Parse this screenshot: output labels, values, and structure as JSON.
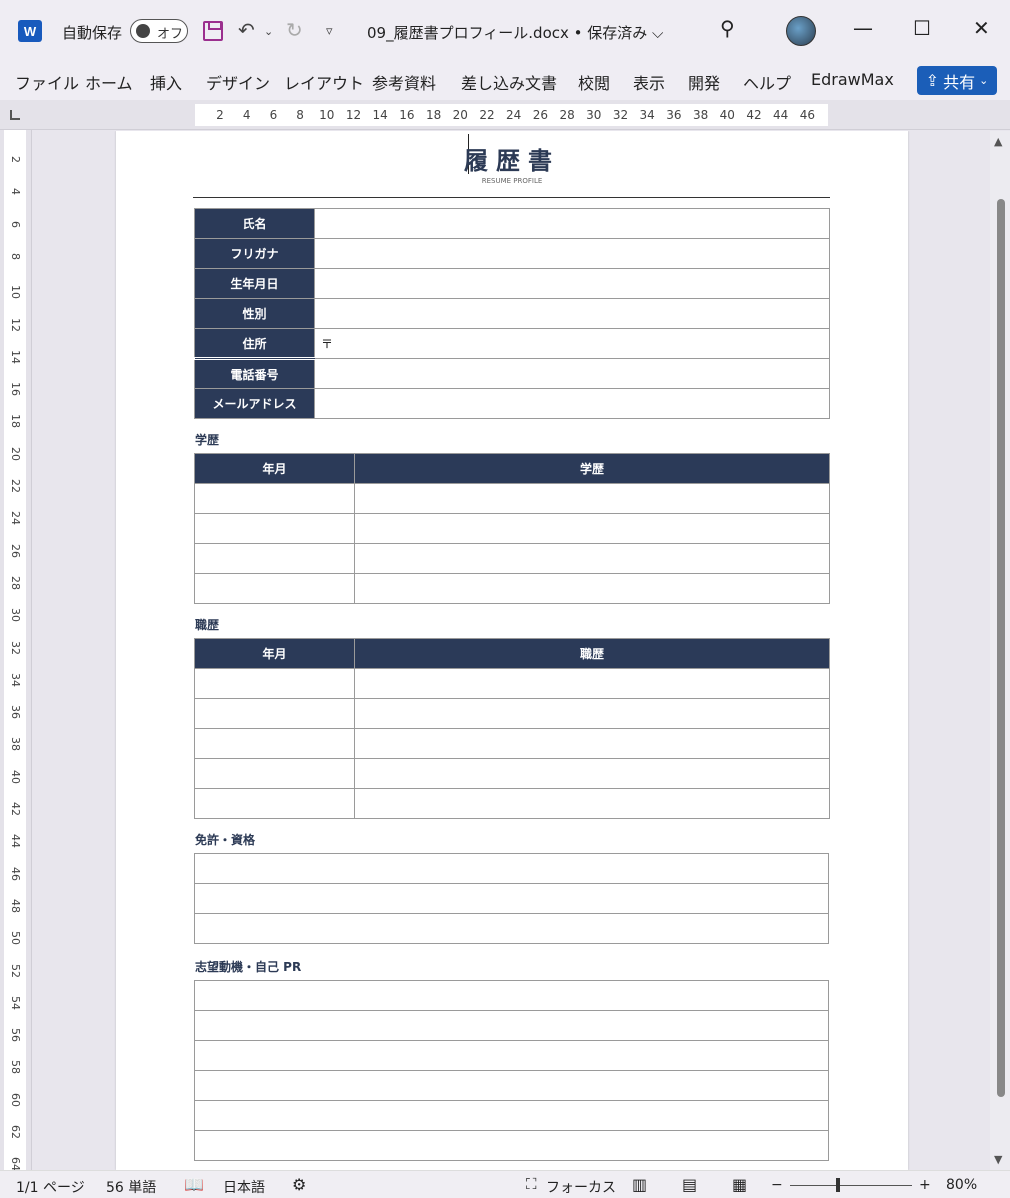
{
  "titlebar": {
    "autosave_label": "自動保存",
    "toggle_state": "オフ",
    "doc_title": "09_履歴書プロフィール.docx • 保存済み ⌵"
  },
  "ribbon": {
    "tabs": [
      "ファイル",
      "ホーム",
      "挿入",
      "デザイン",
      "レイアウト",
      "参考資料",
      "差し込み文書",
      "校閲",
      "表示",
      "開発",
      "ヘルプ",
      "EdrawMax"
    ],
    "share_label": "共有"
  },
  "ruler": {
    "marks": [
      "2",
      "4",
      "6",
      "8",
      "10",
      "12",
      "14",
      "16",
      "18",
      "20",
      "22",
      "24",
      "26",
      "28",
      "30",
      "32",
      "34",
      "36",
      "38",
      "40",
      "42",
      "44",
      "46"
    ],
    "vmarks": [
      "2",
      "4",
      "6",
      "8",
      "10",
      "12",
      "14",
      "16",
      "18",
      "20",
      "22",
      "24",
      "26",
      "28",
      "30",
      "32",
      "34",
      "36",
      "38",
      "40",
      "42",
      "44",
      "46",
      "48",
      "50",
      "52",
      "54",
      "56",
      "58",
      "60",
      "62",
      "64"
    ]
  },
  "document": {
    "title": "履歴書",
    "subtitle": "RESUME PROFILE",
    "profile_rows": [
      {
        "label": "氏名",
        "value": ""
      },
      {
        "label": "フリガナ",
        "value": ""
      },
      {
        "label": "生年月日",
        "value": ""
      },
      {
        "label": "性別",
        "value": ""
      },
      {
        "label": "住所",
        "value": "〒"
      },
      {
        "label": "電話番号",
        "value": ""
      },
      {
        "label": "メールアドレス",
        "value": ""
      }
    ],
    "education": {
      "title": "学歴",
      "col_date": "年月",
      "col_content": "学歴"
    },
    "career": {
      "title": "職歴",
      "col_date": "年月",
      "col_content": "職歴"
    },
    "licenses": {
      "title": "免許・資格"
    },
    "motivation": {
      "title": "志望動機・自己 PR"
    }
  },
  "statusbar": {
    "page": "1/1 ページ",
    "words": "56 単語",
    "language": "日本語",
    "focus": "フォーカス",
    "zoom": "80%"
  },
  "colors": {
    "header_navy": "#2b3a58",
    "share_blue": "#1b5eb8",
    "save_purple": "#9b2f8e"
  }
}
